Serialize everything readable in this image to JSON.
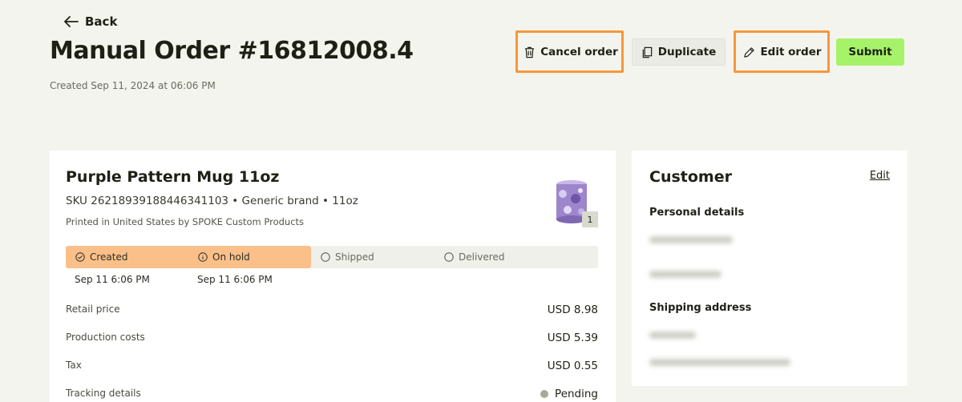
{
  "header": {
    "back_label": "Back",
    "title": "Manual Order #16812008.4",
    "created": "Created Sep 11, 2024 at 06:06 PM"
  },
  "actions": {
    "cancel_label": "Cancel order",
    "duplicate_label": "Duplicate",
    "edit_label": "Edit order",
    "submit_label": "Submit",
    "highlight_color": "#f7973a",
    "submit_color": "#a6f36a"
  },
  "product": {
    "name": "Purple Pattern Mug 11oz",
    "sku": "SKU 26218939188446341103",
    "brand_size": " • Generic brand • 11oz",
    "printed": "Printed in United States by SPOKE Custom Products",
    "quantity": "1",
    "status_steps": [
      {
        "label": "Created",
        "date": "Sep 11 6:06 PM",
        "state": "done"
      },
      {
        "label": "On hold",
        "date": "Sep 11 6:06 PM",
        "state": "current"
      },
      {
        "label": "Shipped",
        "date": "",
        "state": "pending"
      },
      {
        "label": "Delivered",
        "date": "",
        "state": "pending"
      }
    ],
    "progress_color": "#fbc08a",
    "rows": [
      {
        "label": "Retail price",
        "value": "USD 8.98"
      },
      {
        "label": "Production costs",
        "value": "USD 5.39"
      },
      {
        "label": "Tax",
        "value": "USD 0.55"
      },
      {
        "label": "Tracking details",
        "value": "Pending"
      }
    ]
  },
  "customer": {
    "title": "Customer",
    "edit_label": "Edit",
    "personal_heading": "Personal details",
    "shipping_heading": "Shipping address"
  }
}
